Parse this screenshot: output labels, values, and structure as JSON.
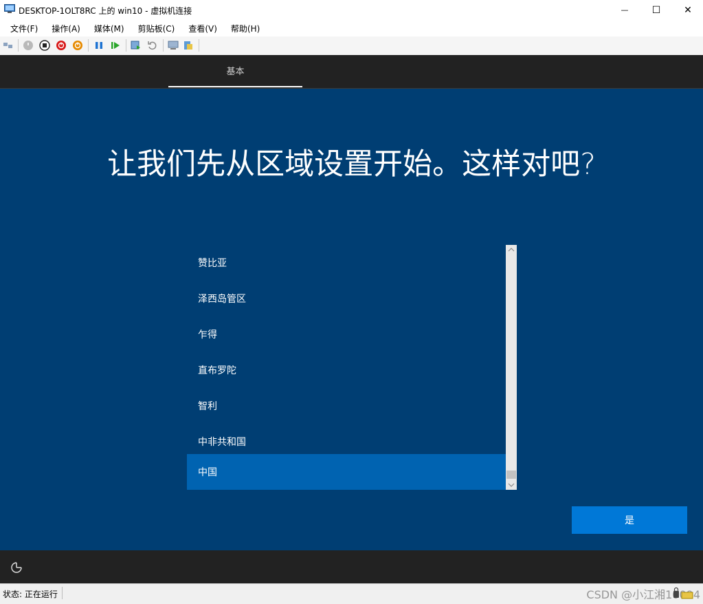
{
  "window": {
    "title": "DESKTOP-1OLT8RC 上的 win10 - 虚拟机连接",
    "minimize_glyph": "—",
    "maximize_glyph": "☐",
    "close_glyph": "✕"
  },
  "menu": [
    "文件(F)",
    "操作(A)",
    "媒体(M)",
    "剪贴板(C)",
    "查看(V)",
    "帮助(H)"
  ],
  "toolbar": {
    "icons": [
      "ctrl-alt-del-icon",
      "start-icon",
      "turn-off-icon",
      "shut-down-icon",
      "save-icon",
      "pause-icon",
      "reset-icon",
      "checkpoint-icon",
      "revert-icon",
      "enhanced-session-icon",
      "share-icon"
    ]
  },
  "vm": {
    "tab_label": "基本",
    "heading": "让我们先从区域设置开始。这样对吧?",
    "regions": [
      "赞比亚",
      "泽西岛管区",
      "乍得",
      "直布罗陀",
      "智利",
      "中非共和国",
      "中国"
    ],
    "selected_region": "中国",
    "yes_label": "是",
    "ease_of_access_icon": "ease-of-access-icon"
  },
  "status": {
    "text": "状态: 正在运行",
    "watermark": "CSDN @小江湘10094"
  },
  "colors": {
    "vm_background": "#003e73",
    "selected_item": "#0063b1",
    "yes_button": "#0078d7",
    "bar_dark": "#222222"
  }
}
